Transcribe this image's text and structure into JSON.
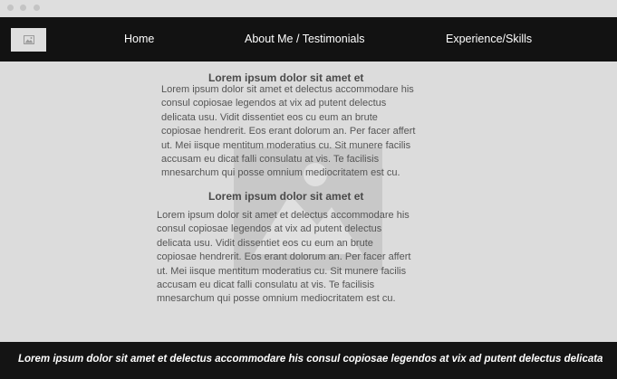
{
  "nav": {
    "items": [
      {
        "label": "Home"
      },
      {
        "label": "About Me / Testimonials"
      },
      {
        "label": "Experience/Skills"
      }
    ]
  },
  "sections": [
    {
      "heading": "Lorem ipsum dolor sit amet et",
      "lines": [
        "Lorem ipsum dolor sit amet et delectus accommodare his",
        "consul copiosae legendos at vix ad putent delectus",
        "delicata usu. Vidit dissentiet eos cu eum an brute",
        "copiosae hendrerit. Eos erant dolorum an. Per facer affert",
        "ut. Mei iisque mentitum moderatius cu. Sit munere facilis",
        "accusam eu dicat falli consulatu at vis. Te facilisis",
        "mnesarchum qui posse omnium mediocritatem est cu."
      ]
    },
    {
      "heading": "Lorem ipsum dolor sit amet et",
      "lines": [
        "Lorem ipsum dolor sit amet et delectus accommodare his",
        "consul copiosae legendos at vix ad putent delectus",
        "delicata usu. Vidit dissentiet eos cu eum an brute",
        "copiosae hendrerit. Eos erant dolorum an. Per facer affert",
        "ut. Mei iisque mentitum moderatius cu. Sit munere facilis",
        "accusam eu dicat falli consulatu at vis. Te facilisis",
        "mnesarchum qui posse omnium mediocritatem est cu."
      ]
    }
  ],
  "footer": {
    "text": "Lorem ipsum dolor sit amet et delectus accommodare his consul copiosae legendos at vix ad putent delectus delicata"
  },
  "icons": {
    "logo": "image-placeholder-icon",
    "background": "image-placeholder-icon"
  },
  "colors": {
    "nav_bg": "#121212",
    "page_bg": "#dcdcdc",
    "footer_bg": "#141414",
    "text": "#555555"
  }
}
